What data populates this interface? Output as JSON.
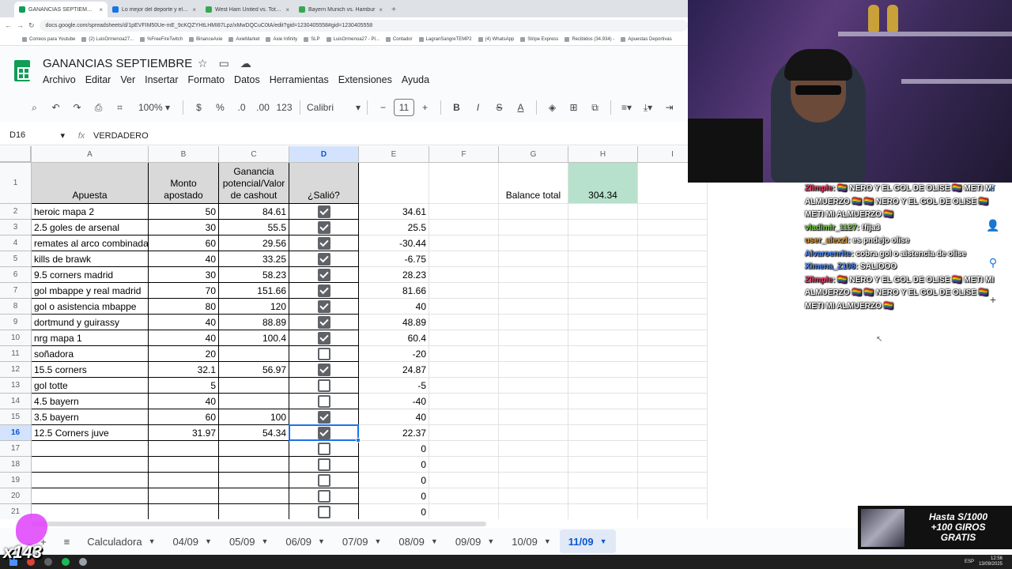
{
  "browser": {
    "tabs": [
      {
        "label": "GANANCIAS SEPTIEMBRE - Ho",
        "active": true,
        "color": "#0f9d58"
      },
      {
        "label": "Lo mejor del deporte y el entre",
        "active": false,
        "color": "#1a73e8"
      },
      {
        "label": "West Ham United vs. Tottenham",
        "active": false,
        "color": "#34a853"
      },
      {
        "label": "Bayern Munich vs. Hambur",
        "active": false,
        "color": "#34a853"
      }
    ],
    "url": "docs.google.com/spreadsheets/d/1pEVFIM50Ue-mE_9cKQZYHtLHMI87Lpz/xMwDQCuC0tA/edit?gid=1230405558#gid=1230405558",
    "bookmarks": [
      "Correos para Youtube",
      "(2) LuisOrmenoa27...",
      "%FreeFireTwitch",
      "BinanceAxie",
      "AxieMarket",
      "Axie Infinity",
      "SLP",
      "LuisOrmenoa27 - Pl...",
      "Contador",
      "LagranSangreTEMP2",
      "(4) WhatsApp",
      "Stripe Express",
      "Recibidos (34.934) -",
      "Apuestas Deportivas"
    ]
  },
  "sheets": {
    "title": "GANANCIAS SEPTIEMBRE",
    "menu": [
      "Archivo",
      "Editar",
      "Ver",
      "Insertar",
      "Formato",
      "Datos",
      "Herramientas",
      "Extensiones",
      "Ayuda"
    ],
    "toolbar": {
      "zoom": "100%",
      "currency": "$",
      "percent": "%",
      "dec_less": ".0",
      "dec_more": ".00",
      "num_format": "123",
      "font": "Calibri",
      "font_size": "11",
      "minus": "−",
      "plus": "+",
      "bold": "B",
      "italic": "I",
      "strike": "S",
      "textcolor": "A"
    },
    "name_box": "D16",
    "formula_value": "VERDADERO"
  },
  "grid": {
    "columns": [
      "A",
      "B",
      "C",
      "D",
      "E",
      "F",
      "G",
      "H",
      "I"
    ],
    "selected_column": "D",
    "headers": {
      "a": "Apuesta",
      "b": "Monto apostado",
      "c": "Ganancia potencial/Valor de cashout",
      "d": "¿Salió?"
    },
    "balance_label": "Balance total",
    "balance_value": "304.34",
    "selected_row": 16,
    "rows": [
      {
        "n": "2",
        "a": "heroic mapa 2",
        "b": "50",
        "c": "84.61",
        "d": true,
        "e": "34.61"
      },
      {
        "n": "3",
        "a": "2.5 goles de arsenal",
        "b": "30",
        "c": "55.5",
        "d": true,
        "e": "25.5"
      },
      {
        "n": "4",
        "a": "remates al arco combinada",
        "b": "60",
        "c": "29.56",
        "d": true,
        "e": "-30.44"
      },
      {
        "n": "5",
        "a": "kills de brawk",
        "b": "40",
        "c": "33.25",
        "d": true,
        "e": "-6.75"
      },
      {
        "n": "6",
        "a": "9.5 corners madrid",
        "b": "30",
        "c": "58.23",
        "d": true,
        "e": "28.23"
      },
      {
        "n": "7",
        "a": "gol mbappe y real madrid",
        "b": "70",
        "c": "151.66",
        "d": true,
        "e": "81.66"
      },
      {
        "n": "8",
        "a": "gol o asistencia mbappe",
        "b": "80",
        "c": "120",
        "d": true,
        "e": "40"
      },
      {
        "n": "9",
        "a": "dortmund y guirassy",
        "b": "40",
        "c": "88.89",
        "d": true,
        "e": "48.89"
      },
      {
        "n": "10",
        "a": "nrg mapa 1",
        "b": "40",
        "c": "100.4",
        "d": true,
        "e": "60.4"
      },
      {
        "n": "11",
        "a": "soñadora",
        "b": "20",
        "c": "",
        "d": false,
        "e": "-20"
      },
      {
        "n": "12",
        "a": "15.5 corners",
        "b": "32.1",
        "c": "56.97",
        "d": true,
        "e": "24.87"
      },
      {
        "n": "13",
        "a": "gol totte",
        "b": "5",
        "c": "",
        "d": false,
        "e": "-5"
      },
      {
        "n": "14",
        "a": "4.5 bayern",
        "b": "40",
        "c": "",
        "d": false,
        "e": "-40"
      },
      {
        "n": "15",
        "a": "3.5 bayern",
        "b": "60",
        "c": "100",
        "d": true,
        "e": "40"
      },
      {
        "n": "16",
        "a": "12.5 Corners juve",
        "b": "31.97",
        "c": "54.34",
        "d": true,
        "e": "22.37"
      },
      {
        "n": "17",
        "a": "",
        "b": "",
        "c": "",
        "d": false,
        "e": "0"
      },
      {
        "n": "18",
        "a": "",
        "b": "",
        "c": "",
        "d": false,
        "e": "0"
      },
      {
        "n": "19",
        "a": "",
        "b": "",
        "c": "",
        "d": false,
        "e": "0"
      },
      {
        "n": "20",
        "a": "",
        "b": "",
        "c": "",
        "d": false,
        "e": "0"
      },
      {
        "n": "21",
        "a": "",
        "b": "",
        "c": "",
        "d": false,
        "e": "0"
      }
    ]
  },
  "sheet_tabs": [
    "Calculadora",
    "04/09",
    "05/09",
    "06/09",
    "07/09",
    "08/09",
    "09/09",
    "10/09",
    "11/09"
  ],
  "active_sheet": "11/09",
  "chat": [
    {
      "user": "Zlimple",
      "text": ": 🏳️‍🌈 NERO Y EL GOL DE OLISE 🏳️‍🌈 METI MI ALMUERZO 🏳️‍🌈 🏳️‍🌈 NERO Y EL GOL DE OLISE 🏳️‍🌈 METI MI ALMUERZO 🏳️‍🌈",
      "cls": "u1"
    },
    {
      "user": "vladimir_1127",
      "text": ": !fija3",
      "cls": "u2"
    },
    {
      "user": "user_alexzl",
      "text": ": es pndejo olise",
      "cls": "u3"
    },
    {
      "user": "Alvaroenrite",
      "text": ": cobra gol o aistencia de olise",
      "cls": "u4"
    },
    {
      "user": "Ximena_Z108",
      "text": ": SALIOOO",
      "cls": "u4"
    },
    {
      "user": "Zlimple",
      "text": ": 🏳️‍🌈 NERO Y EL GOL DE OLISE 🏳️‍🌈 METI MI ALMUERZO 🏳️‍🌈 🏳️‍🌈 NERO Y EL GOL DE OLISE 🏳️‍🌈 METI MI ALMUERZO 🏳️‍🌈",
      "cls": "u1"
    }
  ],
  "promo": {
    "line1": "Hasta S/1000",
    "line2": "+100 GIROS",
    "line3": "GRATIS"
  },
  "brand_text": "x143",
  "taskbar": {
    "lang": "ESP",
    "time": "12:56",
    "date": "13/09/2025"
  },
  "colors": {
    "accent": "#1a73e8",
    "sheets_green": "#0f9d58",
    "header_fill": "#d9d9d9",
    "balance_fill": "#b7e1cd"
  }
}
